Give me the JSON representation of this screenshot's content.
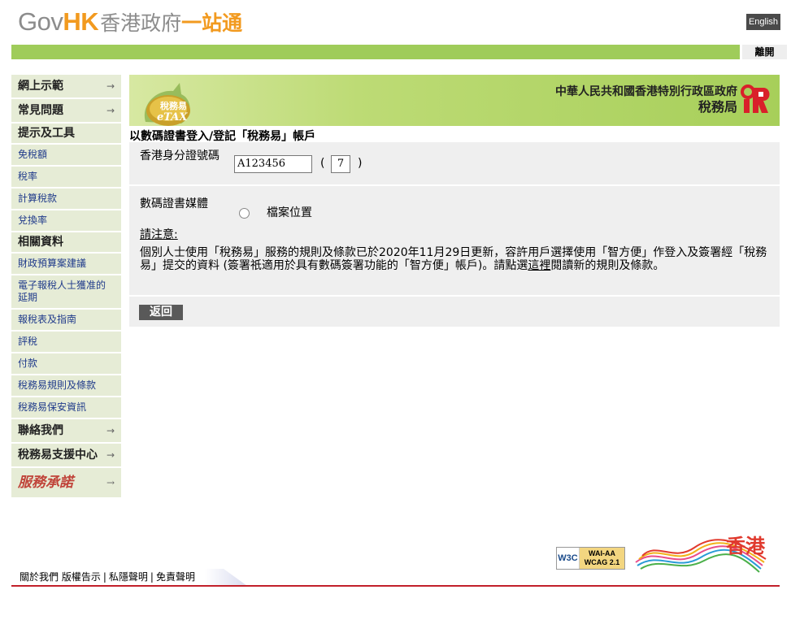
{
  "header": {
    "logo_gov": "Gov",
    "logo_hk": "HK",
    "logo_cn1": "香港政府",
    "logo_cn2": "一站通",
    "english_label": "English",
    "logout_label": "離開"
  },
  "sidebar": {
    "items": [
      {
        "label": "網上示範",
        "type": "main"
      },
      {
        "label": "常見問題",
        "type": "main"
      },
      {
        "label": "提示及工具",
        "type": "heading"
      },
      {
        "label": "免稅額",
        "type": "sub"
      },
      {
        "label": "稅率",
        "type": "sub"
      },
      {
        "label": "計算稅款",
        "type": "sub"
      },
      {
        "label": "兌換率",
        "type": "sub"
      },
      {
        "label": "相關資料",
        "type": "heading"
      },
      {
        "label": "財政預算案建議",
        "type": "sub"
      },
      {
        "label": "電子報稅人士獲准的延期",
        "type": "sub"
      },
      {
        "label": "報稅表及指南",
        "type": "sub"
      },
      {
        "label": "評稅",
        "type": "sub"
      },
      {
        "label": "付款",
        "type": "sub"
      },
      {
        "label": "稅務易規則及條款",
        "type": "sub"
      },
      {
        "label": "稅務易保安資訊",
        "type": "sub"
      },
      {
        "label": "聯絡我們",
        "type": "main"
      },
      {
        "label": "稅務易支援中心",
        "type": "main"
      },
      {
        "label": "服務承諾",
        "type": "brush"
      }
    ],
    "arrow": "→"
  },
  "banner": {
    "etax_cn": "稅務易",
    "etax_en": "eTAX",
    "dept_line1": "中華人民共和國香港特別行政區政府",
    "dept_line2": "稅務局"
  },
  "page": {
    "title": "以數碼證書登入/登記「稅務易」帳戶"
  },
  "form": {
    "hkid_label": "香港身分證號碼",
    "hkid_value": "A123456",
    "check_digit": "7",
    "paren_open": "(",
    "paren_close": ")",
    "media_label": "數碼證書媒體",
    "radio_label": "檔案位置",
    "notice_title": "請注意:",
    "notice_text_before": "個別人士使用「稅務易」服務的規則及條款已於2020年11月29日更新，容許用戶選擇使用「智方便」作登入及簽署經「稅務易」提交的資料 (簽署祇適用於具有數碼簽署功能的「智方便」帳戶)。請點選",
    "notice_link": "這裡",
    "notice_text_after": "閱讀新的規則及條款。",
    "back_label": "返回"
  },
  "footer": {
    "links": [
      "關於我們",
      "版權告示",
      "私隱聲明",
      "免責聲明"
    ],
    "wcag_w3c": "W3C",
    "wcag_level": "WAI-AA",
    "wcag_version": "WCAG 2.1",
    "brand_hk": "香港"
  }
}
